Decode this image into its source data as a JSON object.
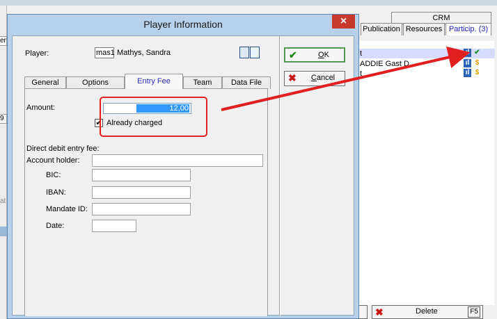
{
  "background": {
    "left_stubs": [
      "er",
      "9",
      "at"
    ],
    "top_tabs": {
      "crm": "CRM"
    },
    "tabs": [
      {
        "label": "Publication",
        "active": false
      },
      {
        "label": "Resources",
        "active": false
      },
      {
        "label": "Particip. (3)",
        "active": true
      }
    ],
    "list_rows": [
      {
        "text": "t",
        "selected": true
      },
      {
        "text": "ADDIE Gast D",
        "selected": false
      },
      {
        "text": "t",
        "selected": false
      }
    ],
    "delete_button": {
      "label": "Delete",
      "shortcut": "F5"
    }
  },
  "dialog": {
    "title": "Player Information",
    "close_label": "×",
    "player": {
      "label": "Player:",
      "code": "mas1",
      "name": "Mathys, Sandra"
    },
    "tabs": [
      {
        "label": "General",
        "active": false
      },
      {
        "label": "Options",
        "active": false
      },
      {
        "label": "Entry Fee",
        "active": true
      },
      {
        "label": "Team",
        "active": false
      },
      {
        "label": "Data File",
        "active": false
      }
    ],
    "entry_fee": {
      "amount_label": "Amount:",
      "amount_value": "12,00",
      "already_charged_label": "Already charged",
      "already_charged_checked": true,
      "check_mark": "✔",
      "direct_debit_heading": "Direct debit entry fee:",
      "fields": [
        {
          "label": "Account holder:",
          "value": ""
        },
        {
          "label": "BIC:",
          "value": ""
        },
        {
          "label": "IBAN:",
          "value": ""
        },
        {
          "label": "Mandate ID:",
          "value": ""
        },
        {
          "label": "Date:",
          "value": ""
        }
      ]
    },
    "buttons": {
      "ok": {
        "label": "OK",
        "icon": "✔"
      },
      "cancel": {
        "label": "Cancel",
        "icon": "✖"
      }
    }
  },
  "colors": {
    "annotation_red": "#e02020",
    "selection_blue": "#3399ff",
    "active_tab_text": "#2b2bb8"
  }
}
